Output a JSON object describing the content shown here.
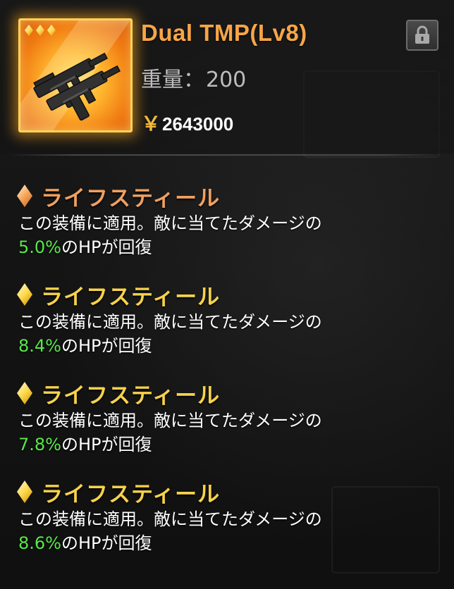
{
  "item": {
    "name": "Dual TMP(Lv8)",
    "weight_label": "重量：",
    "weight_value": "200",
    "currency_symbol": "￥",
    "price": "2643000",
    "rarity_count": 3,
    "icon": "dual-smg-weapon-icon",
    "frame_color": "#ffd35a"
  },
  "lock": {
    "icon": "lock-icon"
  },
  "effects": [
    {
      "title": "ライフスティール",
      "desc_line1": "この装備に適用。敵に当てたダメージの",
      "percent": "5.0%",
      "desc_line2": "のHPが回復",
      "gem_color": "orange"
    },
    {
      "title": "ライフスティール",
      "desc_line1": "この装備に適用。敵に当てたダメージの",
      "percent": "8.4%",
      "desc_line2": "のHPが回復",
      "gem_color": "gold"
    },
    {
      "title": "ライフスティール",
      "desc_line1": "この装備に適用。敵に当てたダメージの",
      "percent": "7.8%",
      "desc_line2": "のHPが回復",
      "gem_color": "gold"
    },
    {
      "title": "ライフスティール",
      "desc_line1": "この装備に適用。敵に当てたダメージの",
      "percent": "8.6%",
      "desc_line2": "のHPが回復",
      "gem_color": "gold"
    }
  ],
  "colors": {
    "name": "#f7a548",
    "percent": "#58e84a",
    "title_orange": "#f1a060",
    "title_gold": "#f7d24b"
  }
}
